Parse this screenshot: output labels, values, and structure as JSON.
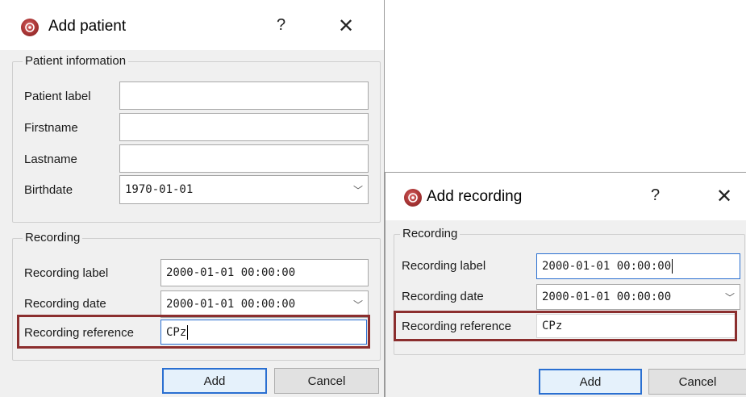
{
  "add_patient": {
    "title": "Add patient",
    "help": "?",
    "close": "✕",
    "patient_group": {
      "title": "Patient information",
      "patient_label_label": "Patient label",
      "patient_label_value": "",
      "firstname_label": "Firstname",
      "firstname_value": "",
      "lastname_label": "Lastname",
      "lastname_value": "",
      "birthdate_label": "Birthdate",
      "birthdate_value": "1970-01-01"
    },
    "recording_group": {
      "title": "Recording",
      "recording_label_label": "Recording label",
      "recording_label_value": "2000-01-01 00:00:00",
      "recording_date_label": "Recording date",
      "recording_date_value": "2000-01-01 00:00:00",
      "recording_reference_label": "Recording reference",
      "recording_reference_value": "CPz"
    },
    "add_button": "Add",
    "cancel_button": "Cancel"
  },
  "add_recording": {
    "title": "Add recording",
    "help": "?",
    "close": "✕",
    "recording_group": {
      "title": "Recording",
      "recording_label_label": "Recording label",
      "recording_label_value": "2000-01-01 00:00:00",
      "recording_date_label": "Recording date",
      "recording_date_value": "2000-01-01 00:00:00",
      "recording_reference_label": "Recording reference",
      "recording_reference_value": "CPz"
    },
    "add_button": "Add",
    "cancel_button": "Cancel"
  },
  "colors": {
    "highlight": "#8b2e2e",
    "focus": "#2a6fd1",
    "dialog_bg": "#f0f0f0"
  }
}
